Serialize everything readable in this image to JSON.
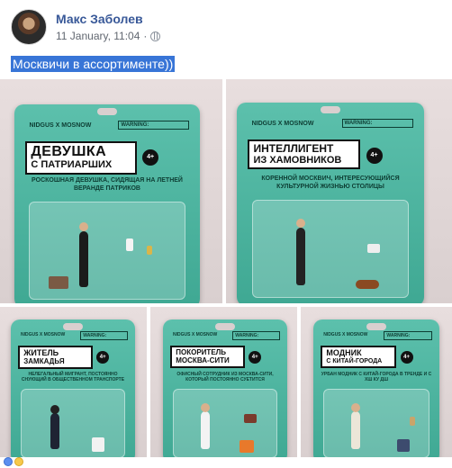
{
  "post": {
    "author": "Макс Заболев",
    "timestamp": "11 January, 11:04",
    "privacy_separator": "·",
    "caption": "Москвичи в ассортименте))"
  },
  "cards": [
    {
      "brand": "NIDGUS X MOSNOW",
      "warning": "WARNING:",
      "title1": "ДЕВУШКА",
      "title2": "С ПАТРИАРШИХ",
      "age": "4+",
      "desc": "РОСКОШНАЯ ДЕВУШКА, СИДЯЩАЯ НА ЛЕТНЕЙ ВЕРАНДЕ ПАТРИКОВ"
    },
    {
      "brand": "NIDGUS X MOSNOW",
      "warning": "WARNING:",
      "title1": "ИНТЕЛЛИГЕНТ",
      "title2": "ИЗ ХАМОВНИКОВ",
      "age": "4+",
      "desc": "КОРЕННОЙ МОСКВИЧ, ИНТЕРЕСУЮЩИЙСЯ КУЛЬТУРНОЙ ЖИЗНЬЮ СТОЛИЦЫ"
    },
    {
      "brand": "NIDGUS X MOSNOW",
      "warning": "WARNING:",
      "title1": "ЖИТЕЛЬ",
      "title2": "ЗАМКАДЬЯ",
      "age": "4+",
      "desc": "НЕЛЕГАЛЬНЫЙ МИГРАНТ, ПОСТОЯННО СНУЮЩИЙ В ОБЩЕСТВЕННОМ ТРАНСПОРТЕ"
    },
    {
      "brand": "NIDGUS X MOSNOW",
      "warning": "WARNING:",
      "title1": "ПОКОРИТЕЛЬ",
      "title2": "МОСКВА-СИТИ",
      "age": "4+",
      "desc": "ОФИСНЫЙ СОТРУДНИК ИЗ МОСКВА-СИТИ, КОТОРЫЙ ПОСТОЯННО СУЕТИТСЯ"
    },
    {
      "brand": "NIDGUS X MOSNOW",
      "warning": "WARNING:",
      "title1": "МОДНИК",
      "title2": "С КИТАЙ-ГОРОДА",
      "age": "4+",
      "desc": "УРБАН МОДНИК С КИТАЙ-ГОРОДА В ТРЕНДЕ И С ХШ КУ ДШ"
    }
  ],
  "colors": {
    "card": "#4bb39e",
    "link": "#385898",
    "selection": "#3875d7",
    "background": "#e5dcdc"
  },
  "icons": {
    "privacy": "globe-icon",
    "reactions": [
      "like-reaction-icon",
      "laugh-reaction-icon"
    ]
  }
}
